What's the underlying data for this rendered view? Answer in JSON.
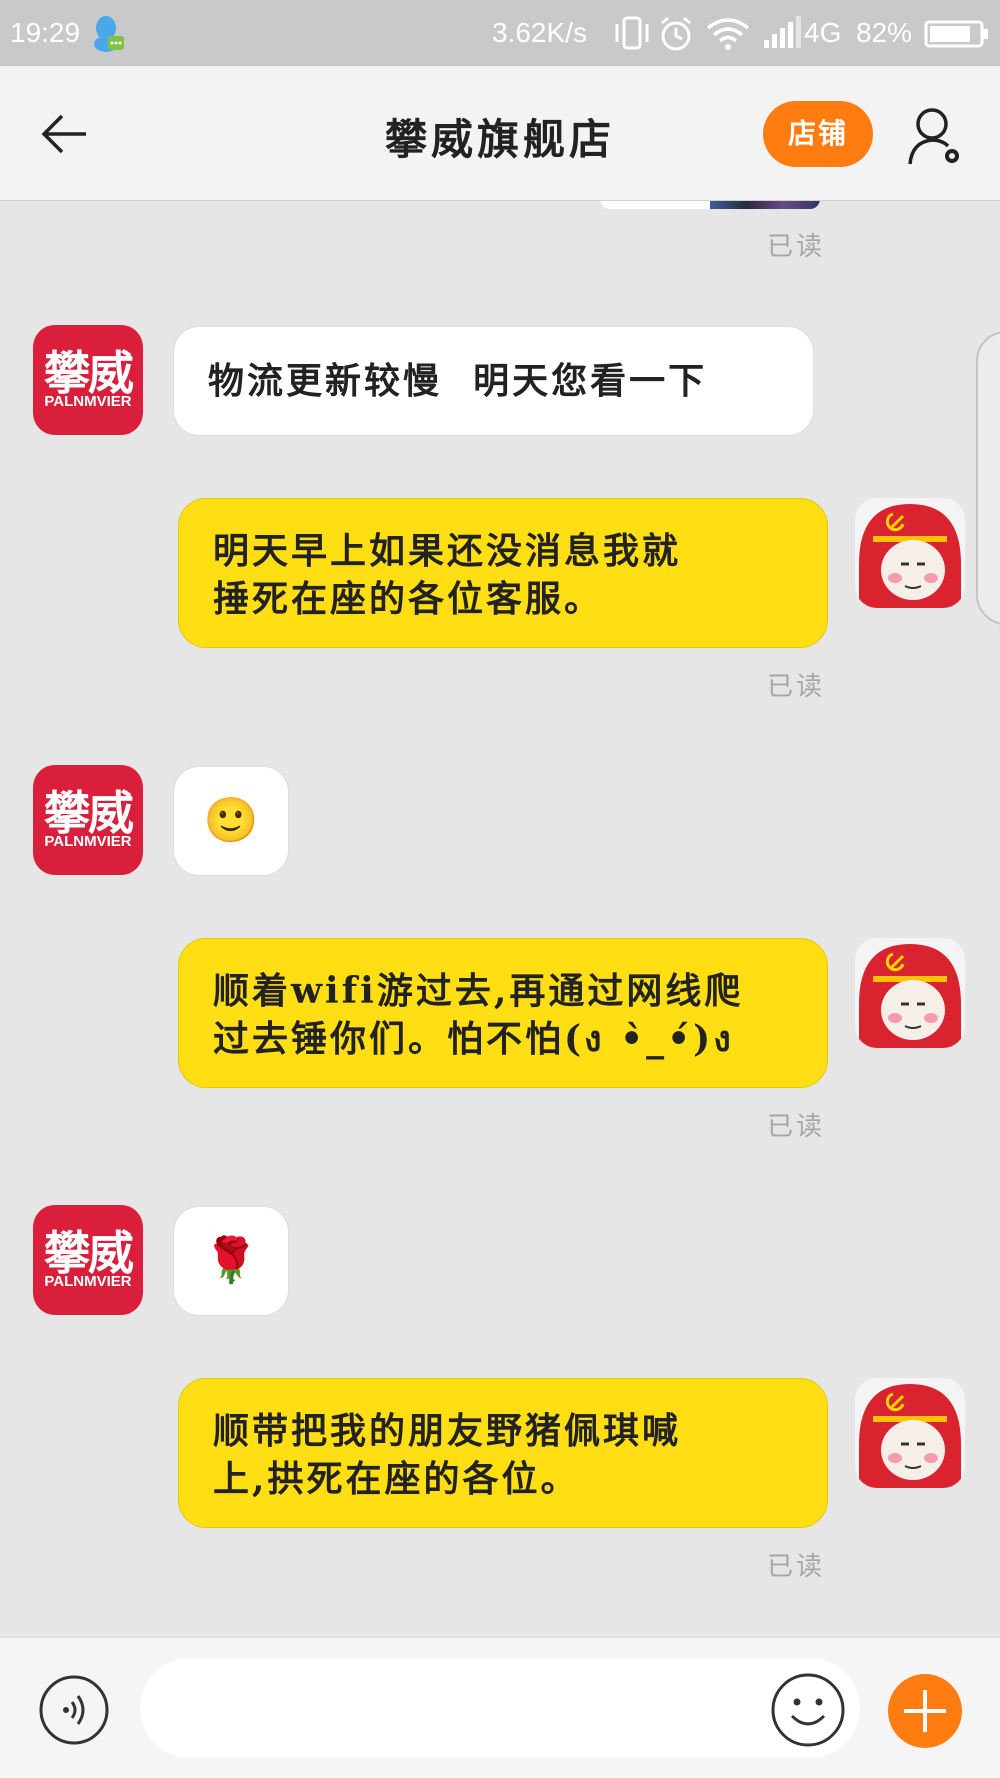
{
  "status_bar": {
    "time": "19:29",
    "net_speed": "3.62K/s",
    "network": "4G",
    "battery": "82%"
  },
  "header": {
    "title": "攀威旗舰店",
    "shop_button": "店铺"
  },
  "shop": {
    "logo_cn": "攀威",
    "logo_en": "PALNMVIER"
  },
  "messages": [
    {
      "from": "shop",
      "text": "物流更新较慢  明天您看一下"
    },
    {
      "from": "me",
      "lines": [
        "明天早上如果还没消息我就",
        "捶死在座的各位客服。"
      ],
      "receipt": "已读"
    },
    {
      "from": "shop",
      "emoji": "🙂"
    },
    {
      "from": "me",
      "lines": [
        "顺着wifi游过去,再通过网线爬",
        "过去锤你们。怕不怕(ง •̀_•́)ง"
      ],
      "receipt": "已读"
    },
    {
      "from": "shop",
      "emoji": "🌹"
    },
    {
      "from": "me",
      "lines": [
        "顺带把我的朋友野猪佩琪喊",
        "上,拱死在座的各位。"
      ],
      "receipt": "已读"
    }
  ],
  "top_receipt": "已读",
  "colors": {
    "accent_orange": "#ff7d10",
    "bubble_yellow": "#ffdf13",
    "shop_red": "#d91f3b"
  },
  "input": {
    "value": "",
    "placeholder": ""
  }
}
